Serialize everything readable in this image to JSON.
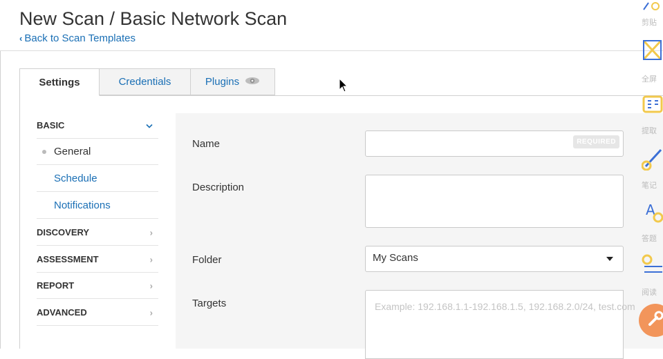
{
  "header": {
    "title": "New Scan / Basic Network Scan",
    "back_link": "Back to Scan Templates"
  },
  "tabs": [
    {
      "label": "Settings",
      "active": true
    },
    {
      "label": "Credentials",
      "active": false
    },
    {
      "label": "Plugins",
      "active": false,
      "icon": "eye-icon"
    }
  ],
  "sidebar": {
    "sections": [
      {
        "label": "BASIC",
        "expanded": true,
        "items": [
          {
            "label": "General",
            "current": true
          },
          {
            "label": "Schedule"
          },
          {
            "label": "Notifications"
          }
        ]
      },
      {
        "label": "DISCOVERY"
      },
      {
        "label": "ASSESSMENT"
      },
      {
        "label": "REPORT"
      },
      {
        "label": "ADVANCED"
      }
    ]
  },
  "form": {
    "name_label": "Name",
    "name_value": "",
    "required_badge": "REQUIRED",
    "description_label": "Description",
    "description_value": "",
    "folder_label": "Folder",
    "folder_value": "My Scans",
    "targets_label": "Targets",
    "targets_placeholder": "Example: 192.168.1.1-192.168.1.5, 192.168.2.0/24, test.com"
  },
  "overlay_toolbar": {
    "labels": [
      "剪贴",
      "全屏",
      "提取",
      "笔记",
      "答题",
      "阅读"
    ]
  },
  "colors": {
    "link": "#1a6fb5",
    "form_bg": "#f5f5f5",
    "accent_orange": "#f2955b"
  }
}
